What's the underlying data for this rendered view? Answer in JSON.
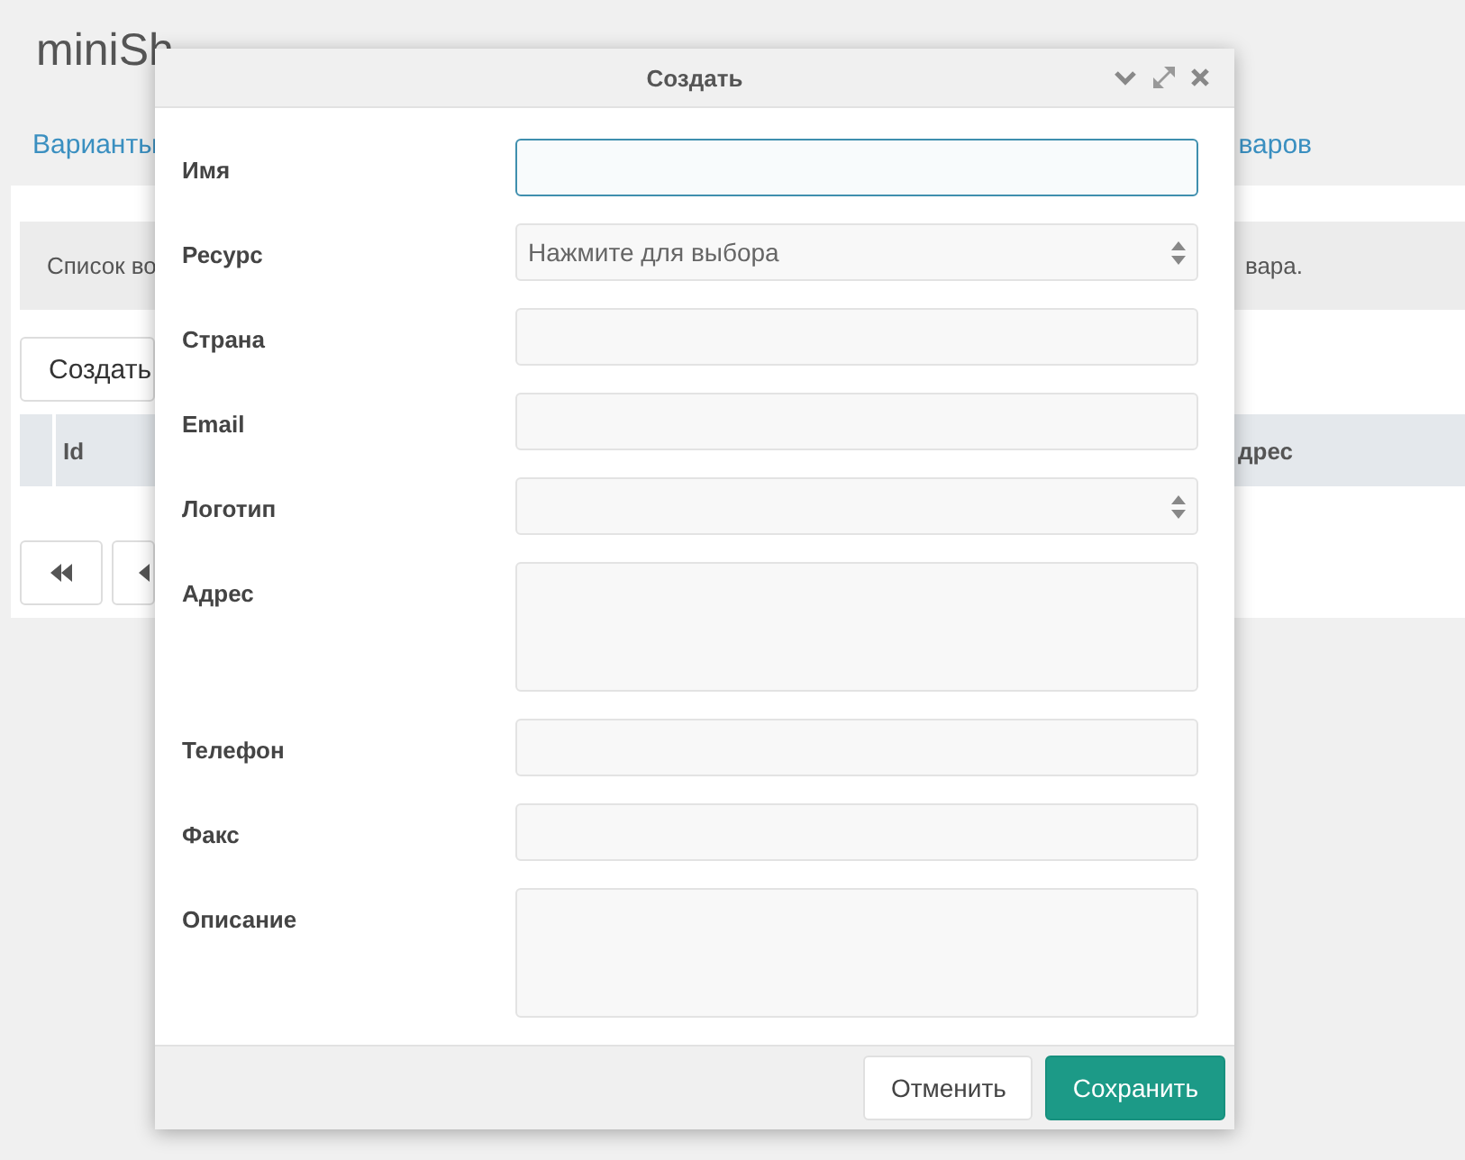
{
  "page": {
    "title": "miniSh",
    "tabs": [
      {
        "label": "Варианты"
      },
      {
        "label": "варов"
      }
    ],
    "info_text": [
      "Список во",
      "вара."
    ],
    "create_button": "Создать",
    "table": {
      "columns": [
        "Id",
        "дрес"
      ]
    },
    "pagination": [
      {
        "kind": "first"
      },
      {
        "kind": "prev"
      }
    ]
  },
  "dialog": {
    "title": "Создать",
    "header_tools": [
      {
        "kind": "collapse"
      },
      {
        "kind": "maximize"
      },
      {
        "kind": "close"
      }
    ],
    "fields": [
      {
        "label": "Имя",
        "kind": "text",
        "focused": true
      },
      {
        "label": "Ресурс",
        "kind": "select",
        "placeholder": "Нажмите для выбора",
        "focused": false
      },
      {
        "label": "Страна",
        "kind": "text",
        "focused": false
      },
      {
        "label": "Email",
        "kind": "text",
        "focused": false
      },
      {
        "label": "Логотип",
        "kind": "select",
        "focused": false
      },
      {
        "label": "Адрес",
        "kind": "textarea",
        "focused": false
      },
      {
        "label": "Телефон",
        "kind": "text",
        "focused": false
      },
      {
        "label": "Факс",
        "kind": "text",
        "focused": false
      },
      {
        "label": "Описание",
        "kind": "textarea",
        "focused": false
      }
    ],
    "buttons": [
      {
        "label": "Отменить",
        "kind": "default"
      },
      {
        "label": "Сохранить",
        "kind": "primary"
      }
    ]
  }
}
